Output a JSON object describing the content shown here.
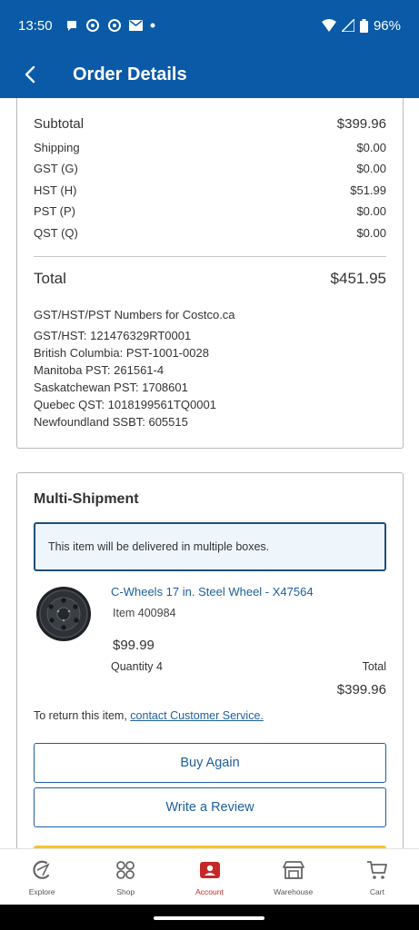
{
  "status_bar": {
    "time": "13:50",
    "battery": "96%"
  },
  "app_bar": {
    "title": "Order Details"
  },
  "summary": {
    "rows": [
      {
        "label": "Subtotal",
        "value": "$399.96"
      },
      {
        "label": "Shipping",
        "value": "$0.00"
      },
      {
        "label": "GST (G)",
        "value": "$0.00"
      },
      {
        "label": "HST (H)",
        "value": "$51.99"
      },
      {
        "label": "PST (P)",
        "value": "$0.00"
      },
      {
        "label": "QST (Q)",
        "value": "$0.00"
      }
    ],
    "total_label": "Total",
    "total_value": "$451.95"
  },
  "tax_numbers": {
    "title": "GST/HST/PST Numbers for Costco.ca",
    "lines": [
      "GST/HST: 121476329RT0001",
      "British Columbia: PST-1001-0028",
      "Manitoba PST: 261561-4",
      "Saskatchewan PST: 1708601",
      "Quebec QST: 1018199561TQ0001",
      "Newfoundland SSBT: 605515"
    ]
  },
  "shipment": {
    "title": "Multi-Shipment",
    "notice": "This item will be delivered in multiple boxes.",
    "product": {
      "name": "C-Wheels 17 in. Steel Wheel - X47564",
      "item": "Item 400984",
      "price": "$99.99",
      "quantity": "Quantity 4",
      "total_label": "Total",
      "total_value": "$399.96"
    },
    "return_prefix": "To return this item, ",
    "return_link": "contact Customer Service.",
    "buy_again": "Buy Again",
    "write_review": "Write a Review"
  },
  "bottom_nav": [
    {
      "label": "Explore",
      "icon": "explore-icon"
    },
    {
      "label": "Shop",
      "icon": "shop-grid-icon"
    },
    {
      "label": "Account",
      "icon": "account-icon",
      "active": true
    },
    {
      "label": "Warehouse",
      "icon": "warehouse-icon"
    },
    {
      "label": "Cart",
      "icon": "cart-icon"
    }
  ],
  "colors": {
    "brand_blue": "#0a5aa7",
    "link_blue": "#1d5f9f",
    "active_red": "#c62828",
    "notice_bg": "#eef6fc",
    "yellow": "#f7c427"
  }
}
